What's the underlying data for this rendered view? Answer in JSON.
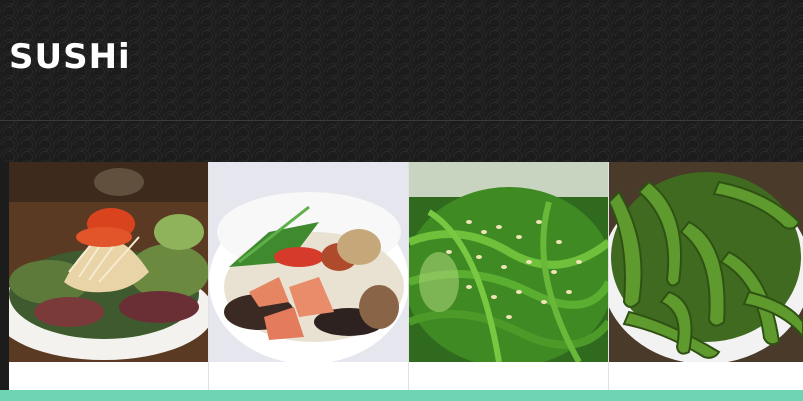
{
  "brand": {
    "logo_text": "SUSH",
    "logo_tail": "i"
  },
  "gallery": {
    "items": [
      {
        "name": "salad-with-roe",
        "icon": "dish-photo"
      },
      {
        "name": "salmon-rice-bowl",
        "icon": "dish-photo"
      },
      {
        "name": "seaweed-salad",
        "icon": "dish-photo"
      },
      {
        "name": "edamame",
        "icon": "dish-photo"
      }
    ]
  },
  "colors": {
    "header_bg": "#1c1c1c",
    "accent": "#6fd4b4",
    "logo": "#ffffff"
  }
}
